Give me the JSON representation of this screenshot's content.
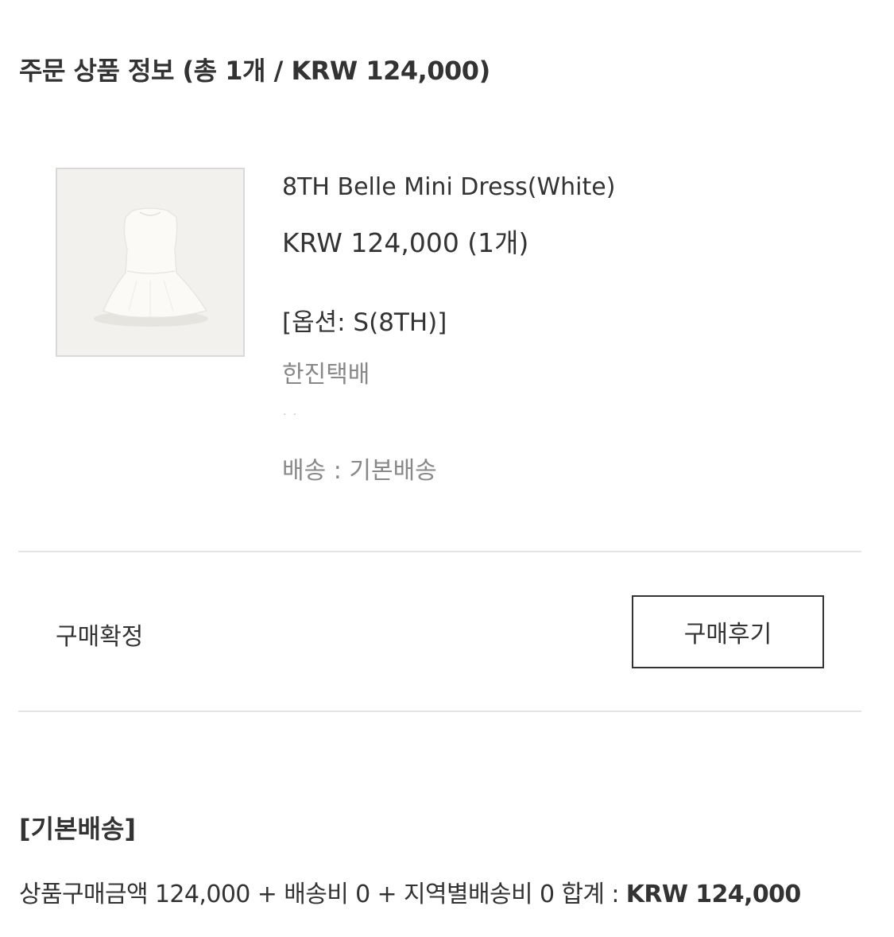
{
  "order_items": {
    "title": "주문 상품 정보 (총 1개 / KRW 124,000)"
  },
  "product": {
    "thumbnail_icon": "white-dress-photo",
    "name": "8TH Belle Mini Dress(White)",
    "price": "KRW 124,000 (1개)",
    "option": "[옵션: S(8TH)]",
    "carrier": "한진택배",
    "tracking_obscured": "· ·",
    "shipping": "배송 : 기본배송"
  },
  "order_status": {
    "label": "구매확정",
    "review_button_label": "구매후기"
  },
  "shipping_group": {
    "title": "[기본배송]",
    "summary_prefix": "상품구매금액 124,000 + 배송비 0 + 지역별배송비 0 합계 : ",
    "summary_total": "KRW 124,000"
  },
  "colors": {
    "text": "#333333",
    "muted_text": "#888888",
    "divider": "#e4e4e4",
    "thumb_border": "#d9d9d9",
    "button_border": "#333333"
  }
}
